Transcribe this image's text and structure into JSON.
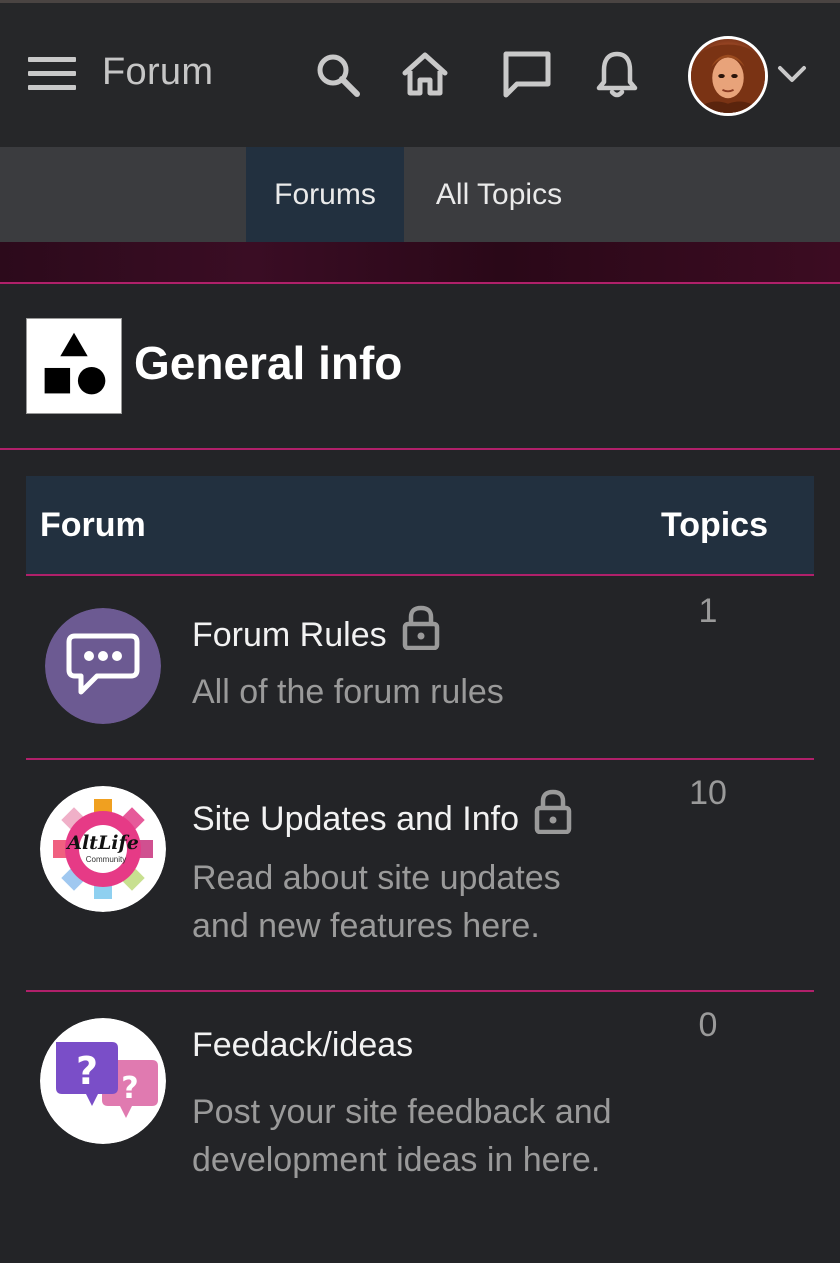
{
  "header": {
    "app_title": "Forum",
    "icons": [
      "menu-icon",
      "search-icon",
      "home-icon",
      "chat-icon",
      "bell-icon",
      "chevron-down-icon"
    ]
  },
  "subnav": {
    "tabs": [
      {
        "label": "Forums",
        "active": true
      },
      {
        "label": "All Topics",
        "active": false
      }
    ]
  },
  "category": {
    "title": "General info",
    "columns": {
      "forum": "Forum",
      "topics": "Topics"
    },
    "forums": [
      {
        "title": "Forum Rules",
        "locked": true,
        "description": "All of the forum rules",
        "topics": "1",
        "icon": "speech-bubble-icon"
      },
      {
        "title": "Site Updates and Info",
        "locked": true,
        "description": "Read about site updates and new features here.",
        "topics": "10",
        "icon": "altlife-community-logo",
        "logo_text": "AltLife",
        "logo_subtext": "Community"
      },
      {
        "title": "Feedack/ideas",
        "locked": false,
        "description": "Post your site feedback and development ideas in here.",
        "topics": "0",
        "icon": "question-bubbles-icon"
      }
    ]
  },
  "colors": {
    "accent": "#b0206a",
    "header_bg": "#262729",
    "table_head_bg": "#22303f",
    "body_bg": "#232427"
  }
}
